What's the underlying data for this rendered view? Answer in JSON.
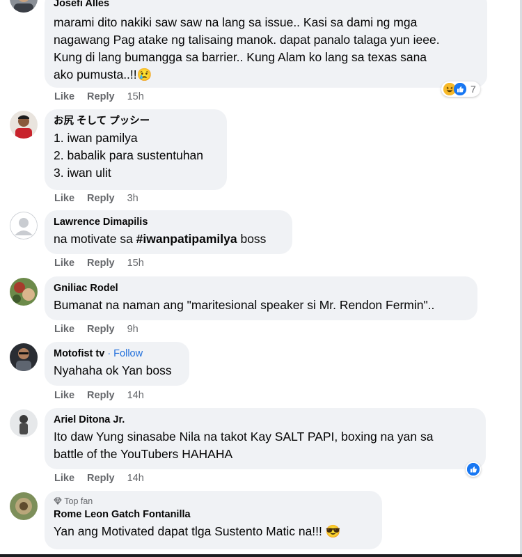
{
  "comments": [
    {
      "author": "Josefi Alles",
      "lines": [
        "marami dito nakiki saw saw na lang sa issue.. Kasi sa dami ng mga",
        "nagawang Pag atake ng talisaing manok. dapat panalo talaga yun ieee.",
        "Kung di lang bumangga sa barrier.. Kung Alam ko lang sa texas sana",
        "ako pumusta..!!😢"
      ],
      "like": "Like",
      "reply": "Reply",
      "time": "15h",
      "reaction_count": "7"
    },
    {
      "author": "お尻 そして プッシー",
      "lines": [
        "1. iwan pamilya",
        "2. babalik para sustentuhan",
        "3. iwan ulit"
      ],
      "like": "Like",
      "reply": "Reply",
      "time": "3h"
    },
    {
      "author": "Lawrence Dimapilis",
      "text_before": "na motivate sa ",
      "hashtag": "#iwanpatipamilya",
      "text_after": " boss",
      "like": "Like",
      "reply": "Reply",
      "time": "15h"
    },
    {
      "author": "Gniliac Rodel",
      "lines": [
        "Bumanat na naman ang \"maritesional speaker si Mr. Rendon Fermin\".."
      ],
      "like": "Like",
      "reply": "Reply",
      "time": "9h"
    },
    {
      "author": "Motofist tv",
      "follow": "· Follow",
      "lines": [
        "Nyahaha ok Yan boss"
      ],
      "like": "Like",
      "reply": "Reply",
      "time": "14h"
    },
    {
      "author": "Ariel Ditona Jr.",
      "lines": [
        "Ito daw Yung sinasabe Nila na takot Kay SALT PAPI, boxing na yan sa",
        "battle of the YouTubers HAHAHA"
      ],
      "like": "Like",
      "reply": "Reply",
      "time": "14h"
    },
    {
      "badge": "Top fan",
      "author": "Rome Leon Gatch Fontanilla",
      "lines": [
        "Yan ang Motivated dapat tlga Sustento Matic na!!! 😎"
      ]
    }
  ],
  "colors": {
    "bubble": "#f0f2f5",
    "meta": "#65676b",
    "link": "#216fdb",
    "like": "#1877f2"
  }
}
